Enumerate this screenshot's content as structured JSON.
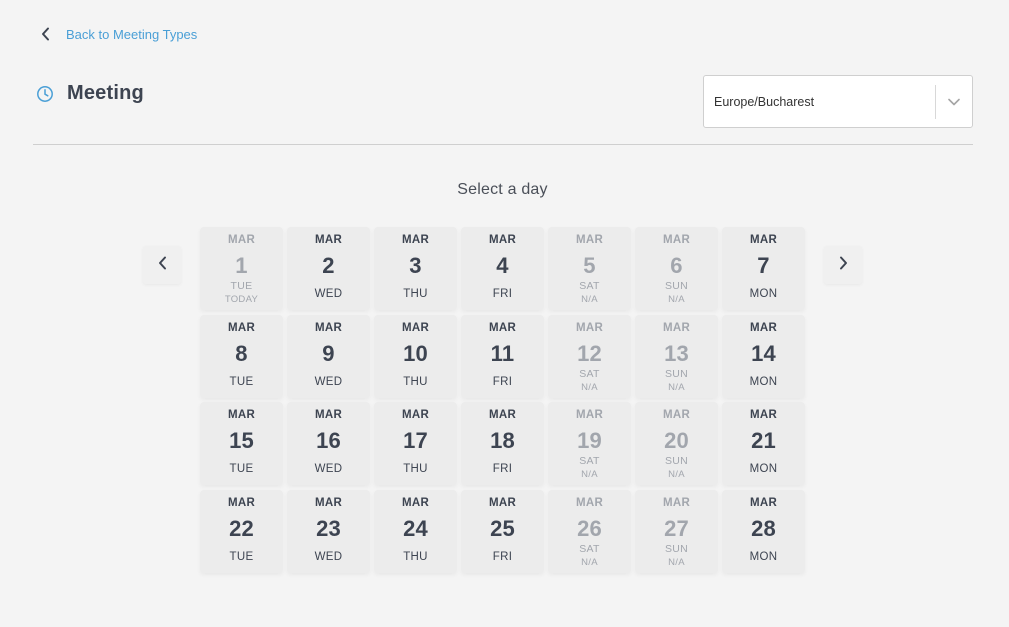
{
  "nav": {
    "back_label": "Back to Meeting Types"
  },
  "header": {
    "title": "Meeting"
  },
  "timezone": {
    "value": "Europe/Bucharest"
  },
  "calendar": {
    "prompt": "Select a day",
    "days": [
      {
        "month": "MAR",
        "day": "1",
        "weekday": "TUE",
        "note": "TODAY",
        "available": false
      },
      {
        "month": "MAR",
        "day": "2",
        "weekday": "WED",
        "note": "",
        "available": true
      },
      {
        "month": "MAR",
        "day": "3",
        "weekday": "THU",
        "note": "",
        "available": true
      },
      {
        "month": "MAR",
        "day": "4",
        "weekday": "FRI",
        "note": "",
        "available": true
      },
      {
        "month": "MAR",
        "day": "5",
        "weekday": "SAT",
        "note": "N/A",
        "available": false
      },
      {
        "month": "MAR",
        "day": "6",
        "weekday": "SUN",
        "note": "N/A",
        "available": false
      },
      {
        "month": "MAR",
        "day": "7",
        "weekday": "MON",
        "note": "",
        "available": true
      },
      {
        "month": "MAR",
        "day": "8",
        "weekday": "TUE",
        "note": "",
        "available": true
      },
      {
        "month": "MAR",
        "day": "9",
        "weekday": "WED",
        "note": "",
        "available": true
      },
      {
        "month": "MAR",
        "day": "10",
        "weekday": "THU",
        "note": "",
        "available": true
      },
      {
        "month": "MAR",
        "day": "11",
        "weekday": "FRI",
        "note": "",
        "available": true
      },
      {
        "month": "MAR",
        "day": "12",
        "weekday": "SAT",
        "note": "N/A",
        "available": false
      },
      {
        "month": "MAR",
        "day": "13",
        "weekday": "SUN",
        "note": "N/A",
        "available": false
      },
      {
        "month": "MAR",
        "day": "14",
        "weekday": "MON",
        "note": "",
        "available": true
      },
      {
        "month": "MAR",
        "day": "15",
        "weekday": "TUE",
        "note": "",
        "available": true
      },
      {
        "month": "MAR",
        "day": "16",
        "weekday": "WED",
        "note": "",
        "available": true
      },
      {
        "month": "MAR",
        "day": "17",
        "weekday": "THU",
        "note": "",
        "available": true
      },
      {
        "month": "MAR",
        "day": "18",
        "weekday": "FRI",
        "note": "",
        "available": true
      },
      {
        "month": "MAR",
        "day": "19",
        "weekday": "SAT",
        "note": "N/A",
        "available": false
      },
      {
        "month": "MAR",
        "day": "20",
        "weekday": "SUN",
        "note": "N/A",
        "available": false
      },
      {
        "month": "MAR",
        "day": "21",
        "weekday": "MON",
        "note": "",
        "available": true
      },
      {
        "month": "MAR",
        "day": "22",
        "weekday": "TUE",
        "note": "",
        "available": true
      },
      {
        "month": "MAR",
        "day": "23",
        "weekday": "WED",
        "note": "",
        "available": true
      },
      {
        "month": "MAR",
        "day": "24",
        "weekday": "THU",
        "note": "",
        "available": true
      },
      {
        "month": "MAR",
        "day": "25",
        "weekday": "FRI",
        "note": "",
        "available": true
      },
      {
        "month": "MAR",
        "day": "26",
        "weekday": "SAT",
        "note": "N/A",
        "available": false
      },
      {
        "month": "MAR",
        "day": "27",
        "weekday": "SUN",
        "note": "N/A",
        "available": false
      },
      {
        "month": "MAR",
        "day": "28",
        "weekday": "MON",
        "note": "",
        "available": true
      }
    ]
  },
  "icons": {
    "back": "chevron-left-icon",
    "clock": "clock-icon",
    "dropdown": "chevron-down-icon",
    "prev": "chevron-left-icon",
    "next": "chevron-right-icon"
  },
  "colors": {
    "link": "#4a9fd6",
    "text": "#3d4451",
    "muted": "#a2a6ad",
    "background": "#f4f4f4",
    "tile": "#ececec"
  }
}
